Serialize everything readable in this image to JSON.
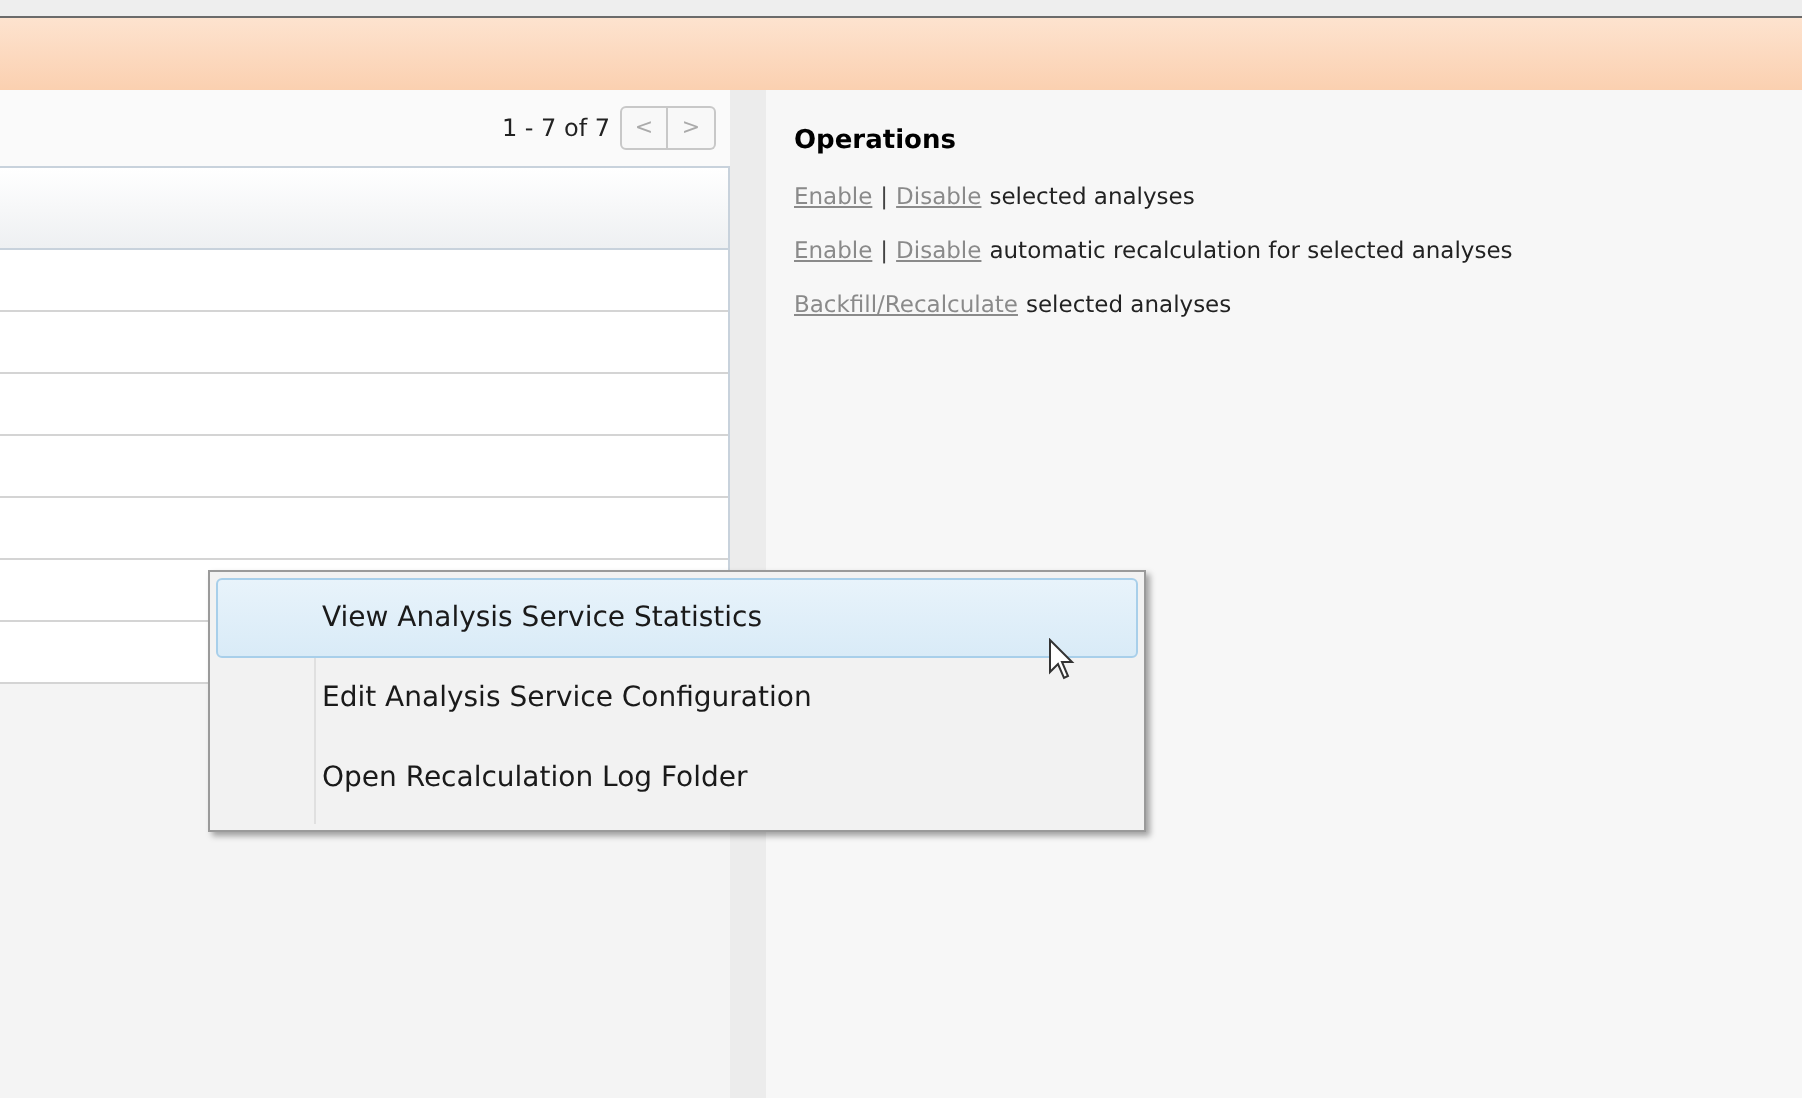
{
  "pager": {
    "range": "1 - 7 of 7",
    "prev": "<",
    "next": ">"
  },
  "operations": {
    "title": "Operations",
    "lines": [
      {
        "links": [
          "Enable",
          "Disable"
        ],
        "separator": "|",
        "text": "selected analyses"
      },
      {
        "links": [
          "Enable",
          "Disable"
        ],
        "separator": "|",
        "text": "automatic recalculation for selected analyses"
      },
      {
        "links": [
          "Backfill/Recalculate"
        ],
        "text": "selected analyses"
      }
    ]
  },
  "context_menu": {
    "items": [
      {
        "label": "View Analysis Service Statistics",
        "selected": true
      },
      {
        "label": "Edit Analysis Service Configuration",
        "selected": false
      },
      {
        "label": "Open Recalculation Log Folder",
        "selected": false
      }
    ]
  }
}
